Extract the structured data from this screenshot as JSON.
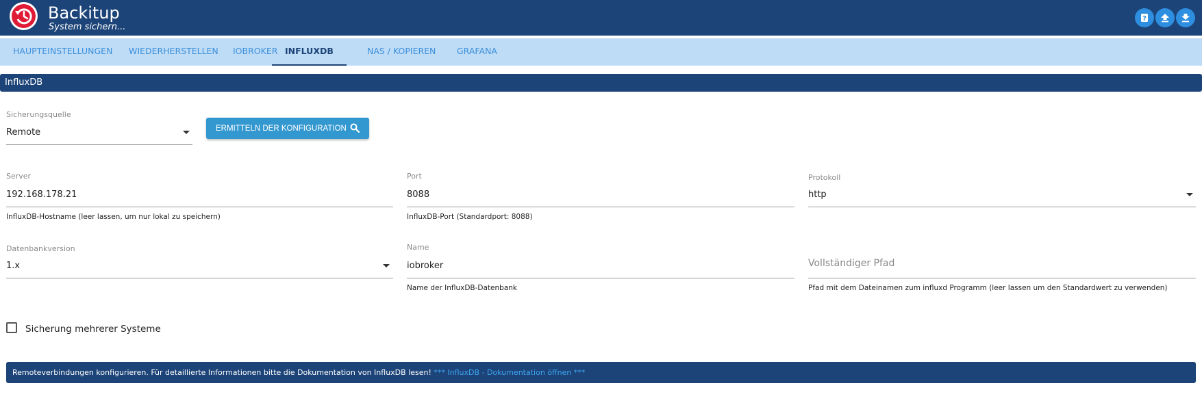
{
  "header": {
    "title": "Backitup",
    "subtitle": "System sichern...",
    "buttons": [
      {
        "icon": "help-icon"
      },
      {
        "icon": "upload-icon"
      },
      {
        "icon": "download-icon"
      }
    ]
  },
  "tabs": [
    {
      "label": "HAUPTEINSTELLUNGEN",
      "active": false
    },
    {
      "label": "WIEDERHERSTELLEN",
      "active": false
    },
    {
      "label": "IOBROKER",
      "active": false
    },
    {
      "label": "INFLUXDB",
      "active": true
    },
    {
      "label": "NAS / KOPIEREN",
      "active": false
    },
    {
      "label": "GRAFANA",
      "active": false
    }
  ],
  "section": {
    "title": "InfluxDB"
  },
  "form": {
    "source": {
      "label": "Sicherungsquelle",
      "value": "Remote"
    },
    "config_button": {
      "label": "ERMITTELN DER KONFIGURATION"
    },
    "server": {
      "label": "Server",
      "value": "192.168.178.21",
      "help": "InfluxDB-Hostname (leer lassen, um nur lokal zu speichern)"
    },
    "port": {
      "label": "Port",
      "value": "8088",
      "help": "InfluxDB-Port (Standardport: 8088)"
    },
    "protocol": {
      "label": "Protokoll",
      "value": "http"
    },
    "db_version": {
      "label": "Datenbankversion",
      "value": "1.x"
    },
    "name": {
      "label": "Name",
      "value": "iobroker",
      "help": "Name der InfluxDB-Datenbank"
    },
    "path": {
      "placeholder": "Vollständiger Pfad",
      "help": "Pfad mit dem Dateinamen zum influxd Programm (leer lassen um den Standardwert zu verwenden)"
    },
    "multi": {
      "label": "Sicherung mehrerer Systeme",
      "checked": false
    }
  },
  "info": {
    "text": "Remoteverbindungen konfigurieren. Für detaillierte Informationen bitte die Dokumentation von InfluxDB lesen!",
    "link": "*** InfluxDB - Dokumentation öffnen ***"
  },
  "colors": {
    "header": "#1c4478",
    "tabbar": "#bfdcf7",
    "accent": "#3498d0",
    "logo": "#e01b36"
  }
}
